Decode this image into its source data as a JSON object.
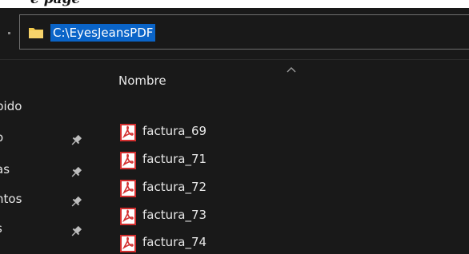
{
  "caption": {
    "text": "e page"
  },
  "address_bar": {
    "path": "C:\\EyesJeansPDF",
    "icon": "folder-icon",
    "selected_color": "#0a64c8"
  },
  "nav_pane": {
    "items": [
      {
        "label": "pido",
        "pinned": false
      },
      {
        "label": "o",
        "pinned": true
      },
      {
        "label": "as",
        "pinned": true
      },
      {
        "label": "ntos",
        "pinned": true
      },
      {
        "label": "s",
        "pinned": true
      }
    ],
    "pin_icon": "pin-icon"
  },
  "content": {
    "column_header": "Nombre",
    "sort_indicator": "chevron-up-icon",
    "files": [
      {
        "name": "factura_69",
        "icon": "pdf-file-icon"
      },
      {
        "name": "factura_71",
        "icon": "pdf-file-icon"
      },
      {
        "name": "factura_72",
        "icon": "pdf-file-icon"
      },
      {
        "name": "factura_73",
        "icon": "pdf-file-icon"
      },
      {
        "name": "factura_74",
        "icon": "pdf-file-icon"
      }
    ]
  },
  "colors": {
    "background": "#191919",
    "text": "#e6e6e6",
    "pdf_red": "#d32f2f",
    "folder_yellow": "#f2c94c"
  }
}
